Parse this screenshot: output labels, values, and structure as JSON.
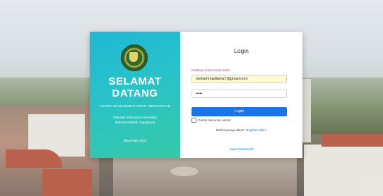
{
  "welcome": {
    "line1": "SELAMAT",
    "line2": "DATANG",
    "subtitle": "SISTEM MANAJEMEN ARSIP UNGGANTIAN",
    "institution_line1": "Fakultas Informasi Universitas",
    "institution_line2": "Muhammadiyah Yogyakarta",
    "copyright": "@Samiajh 2020"
  },
  "login": {
    "title": "Login",
    "hint": "Pastikan kolom telah terisi!",
    "email_value": "mohammadtama7@gmail.com",
    "password_value": "•••••",
    "button_label": "Login",
    "remember_label": "Centsi bila anda admin",
    "no_account_text": "Belum punya akun?",
    "register_link": "Register disini",
    "forgot_link": "Lupa Password?"
  },
  "colors": {
    "panel_gradient_start": "#1fb8d4",
    "panel_gradient_end": "#36c9a6",
    "button": "#1a73e8",
    "hint": "#c2387d",
    "email_autofill_bg": "#fdfbcf"
  }
}
